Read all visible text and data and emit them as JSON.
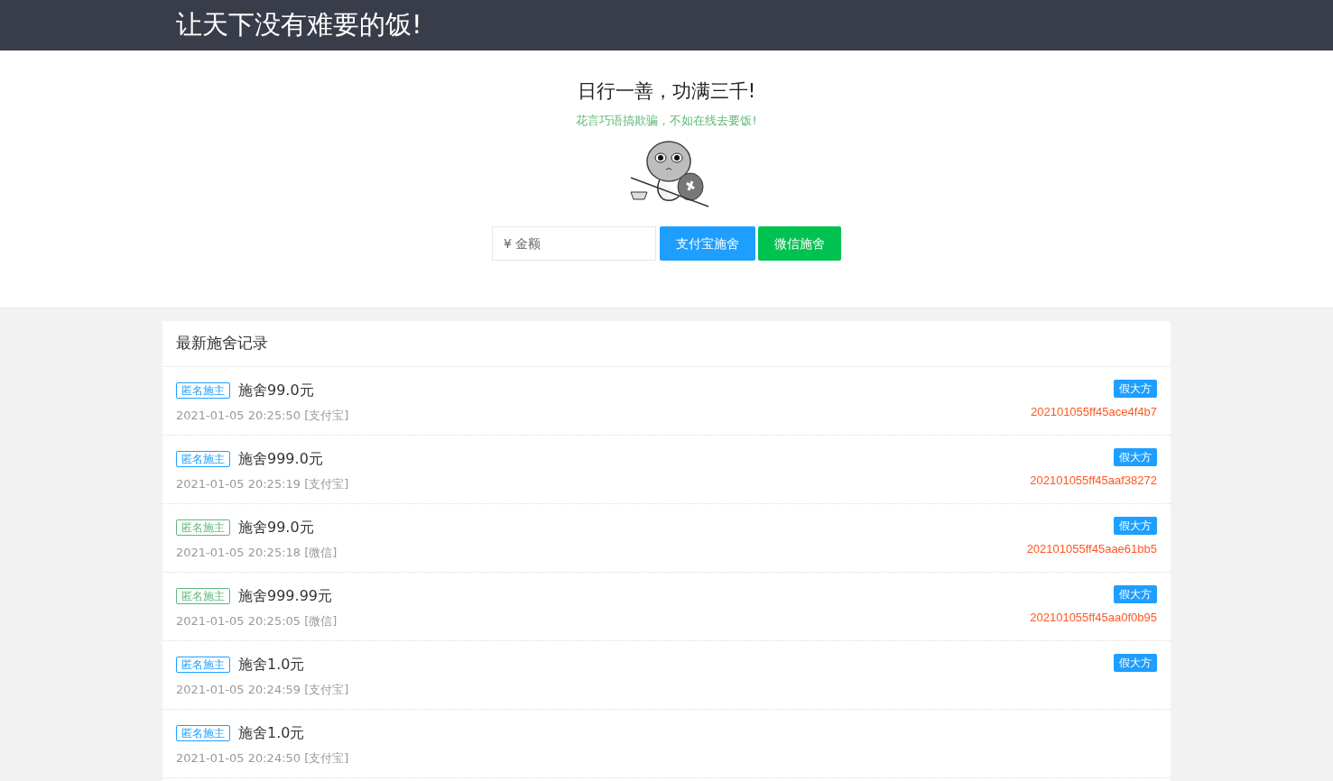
{
  "header": {
    "title": "让天下没有难要的饭!"
  },
  "hero": {
    "title": "日行一善，功满三千!",
    "subtitle": "花言巧语搞欺骗，不如在线去要饭!",
    "amount_field": {
      "placeholder": "¥ 金额"
    },
    "buttons": [
      {
        "label": "支付宝施舍",
        "kind": "alipay"
      },
      {
        "label": "微信施舍",
        "kind": "wechat"
      }
    ]
  },
  "records": {
    "title": "最新施舍记录",
    "items": [
      {
        "tag": "匿名施主",
        "color": "#1e9fff",
        "amount": "施舍99.0元",
        "time": "2021-01-05 20:25:50 [支付宝]",
        "badge": "假大方",
        "order": "202101055ff45ace4f4b7"
      },
      {
        "tag": "匿名施主",
        "color": "#1e9fff",
        "amount": "施舍999.0元",
        "time": "2021-01-05 20:25:19 [支付宝]",
        "badge": "假大方",
        "order": "202101055ff45aaf38272"
      },
      {
        "tag": "匿名施主",
        "color": "#5fb878",
        "amount": "施舍99.0元",
        "time": "2021-01-05 20:25:18 [微信]",
        "badge": "假大方",
        "order": "202101055ff45aae61bb5"
      },
      {
        "tag": "匿名施主",
        "color": "#5fb878",
        "amount": "施舍999.99元",
        "time": "2021-01-05 20:25:05 [微信]",
        "badge": "假大方",
        "order": "202101055ff45aa0f0b95"
      },
      {
        "tag": "匿名施主",
        "color": "#1e9fff",
        "amount": "施舍1.0元",
        "time": "2021-01-05 20:24:59 [支付宝]",
        "badge": "假大方"
      },
      {
        "tag": "匿名施主",
        "color": "#1e9fff",
        "amount": "施舍1.0元",
        "time": "2021-01-05 20:24:50 [支付宝]"
      }
    ]
  }
}
